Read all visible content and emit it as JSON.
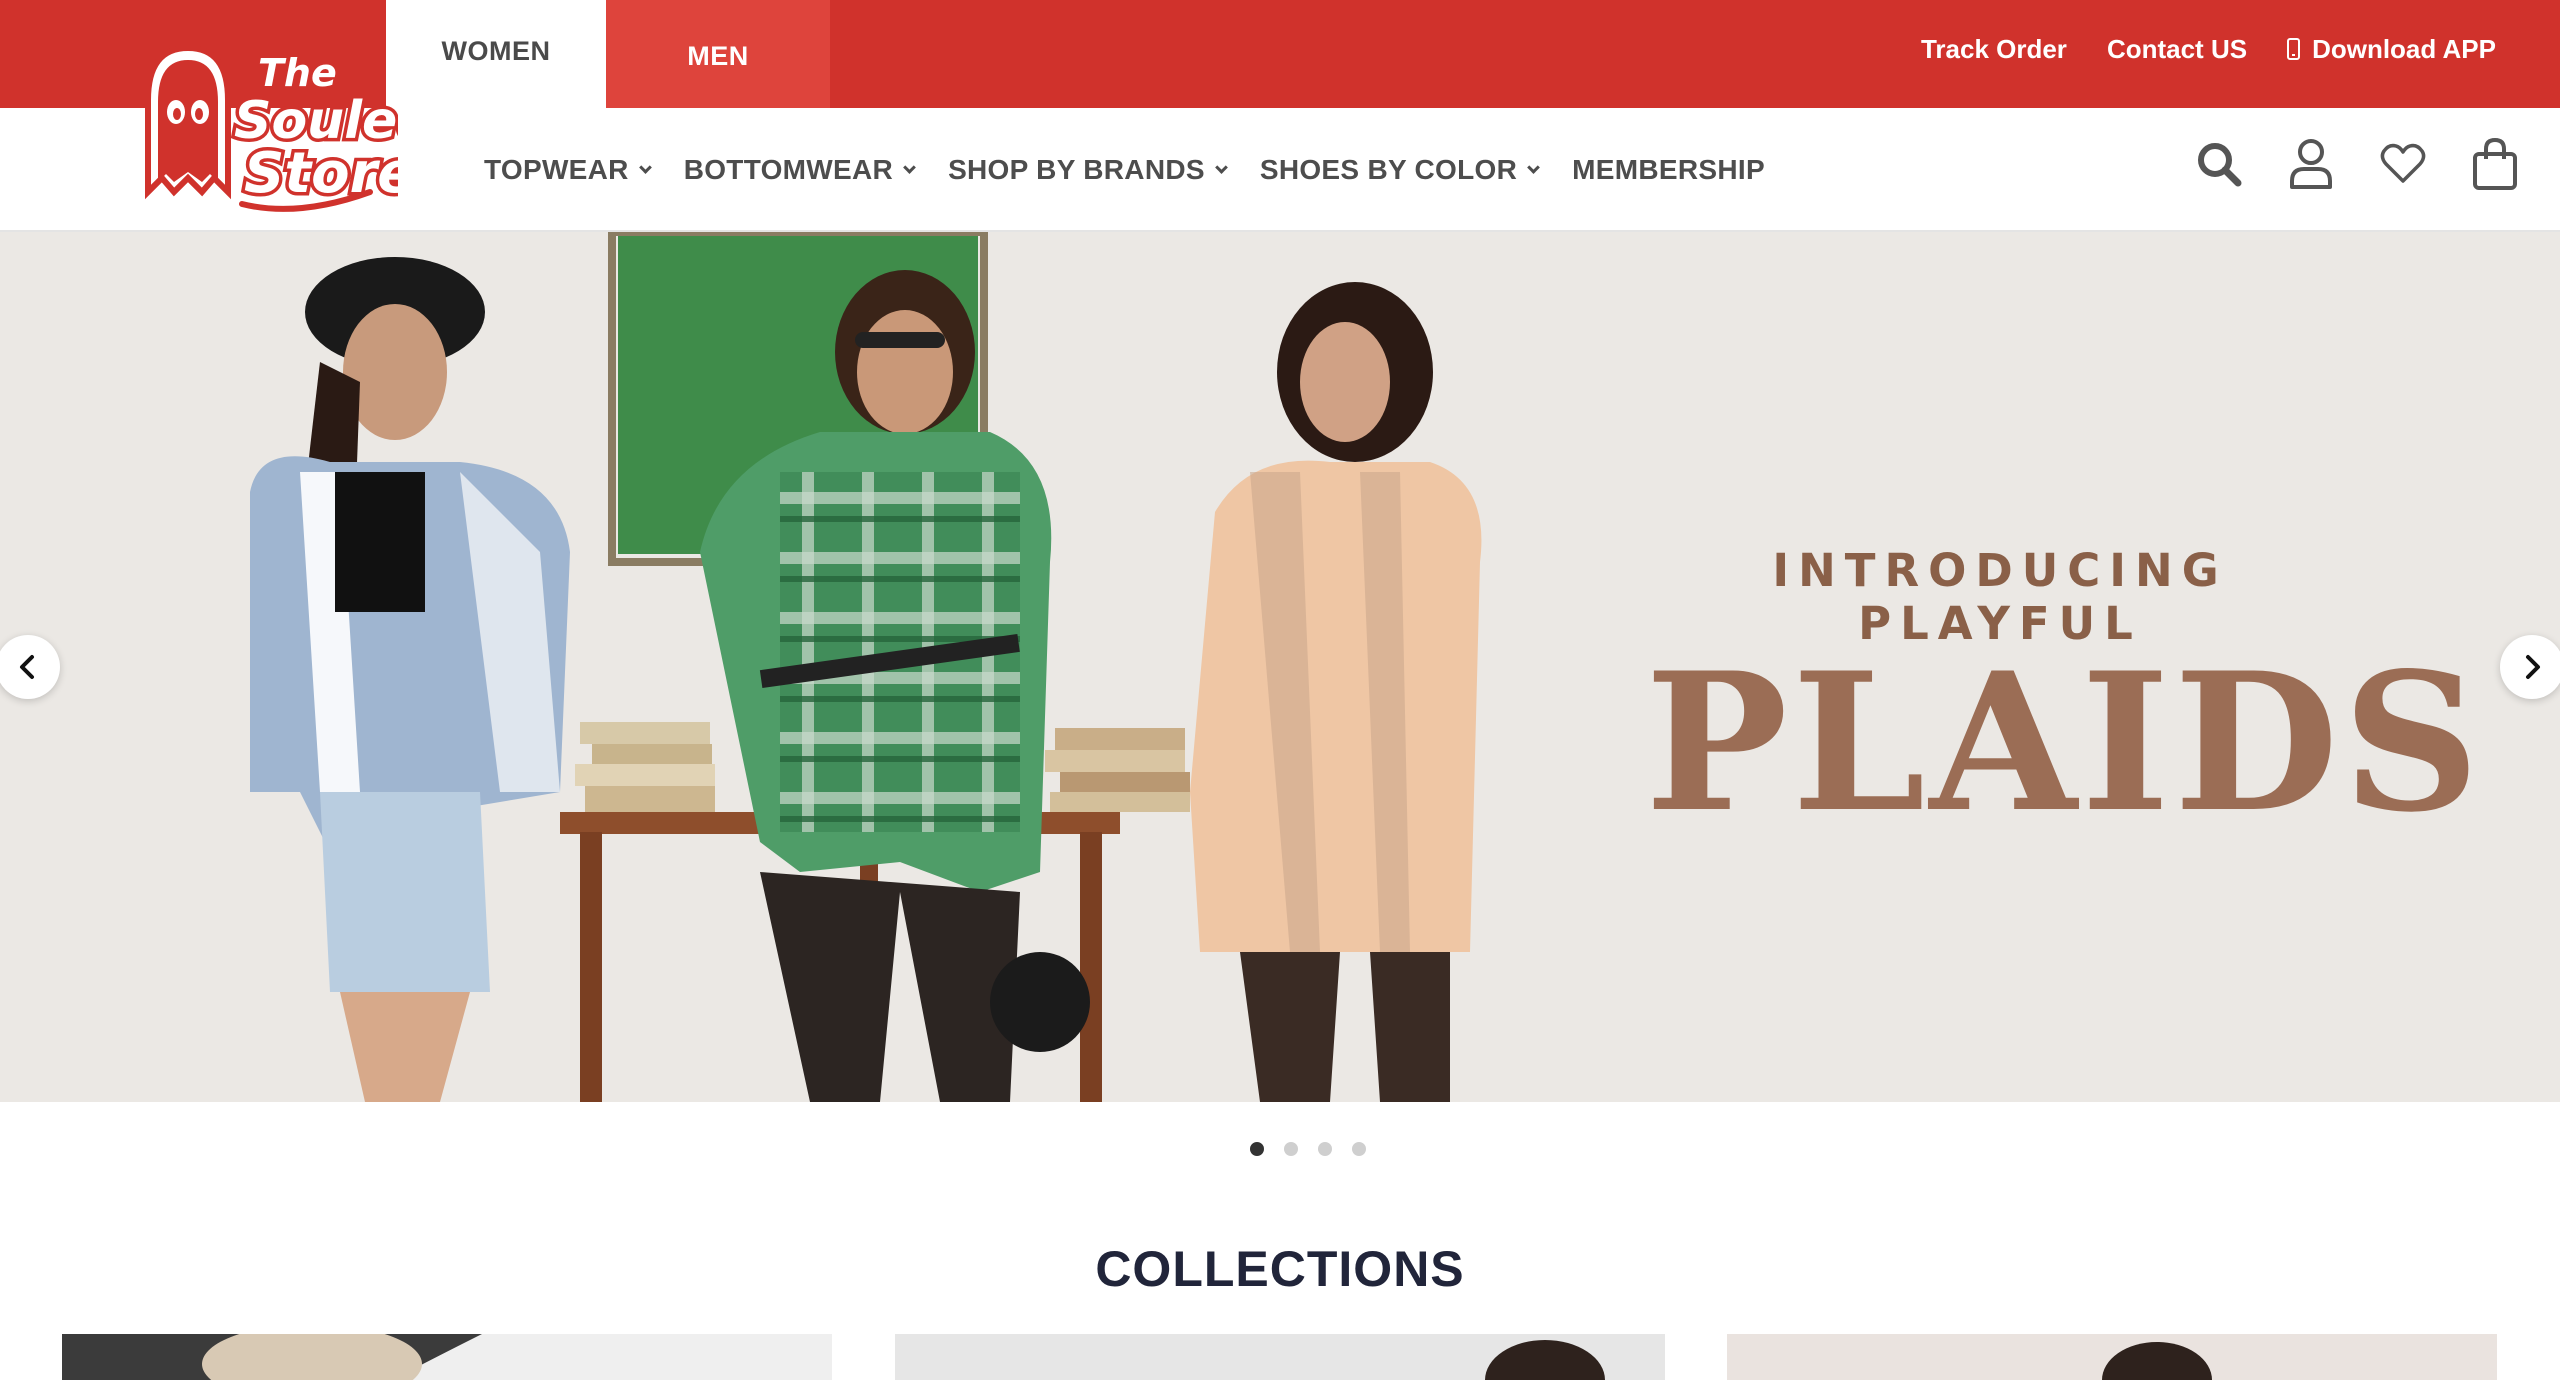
{
  "header": {
    "tabs": [
      {
        "label": "WOMEN",
        "active": true
      },
      {
        "label": "MEN",
        "active": false
      }
    ],
    "links": {
      "track_order": "Track Order",
      "contact_us": "Contact US",
      "download_app": "Download APP"
    },
    "brand_color": "#d0322c"
  },
  "nav": {
    "items": [
      {
        "label": "TOPWEAR",
        "has_dropdown": true
      },
      {
        "label": "BOTTOMWEAR",
        "has_dropdown": true
      },
      {
        "label": "SHOP BY BRANDS",
        "has_dropdown": true
      },
      {
        "label": "SHOES BY COLOR",
        "has_dropdown": true
      },
      {
        "label": "MEMBERSHIP",
        "has_dropdown": false
      }
    ],
    "icons": [
      "search-icon",
      "user-icon",
      "heart-icon",
      "bag-icon"
    ]
  },
  "logo": {
    "line1": "The",
    "line2": "Souled",
    "line3": "Store"
  },
  "hero": {
    "kicker": "INTRODUCING PLAYFUL",
    "title": "PLAIDS",
    "slide_count": 4,
    "active_slide": 1
  },
  "collections": {
    "title": "COLLECTIONS"
  }
}
